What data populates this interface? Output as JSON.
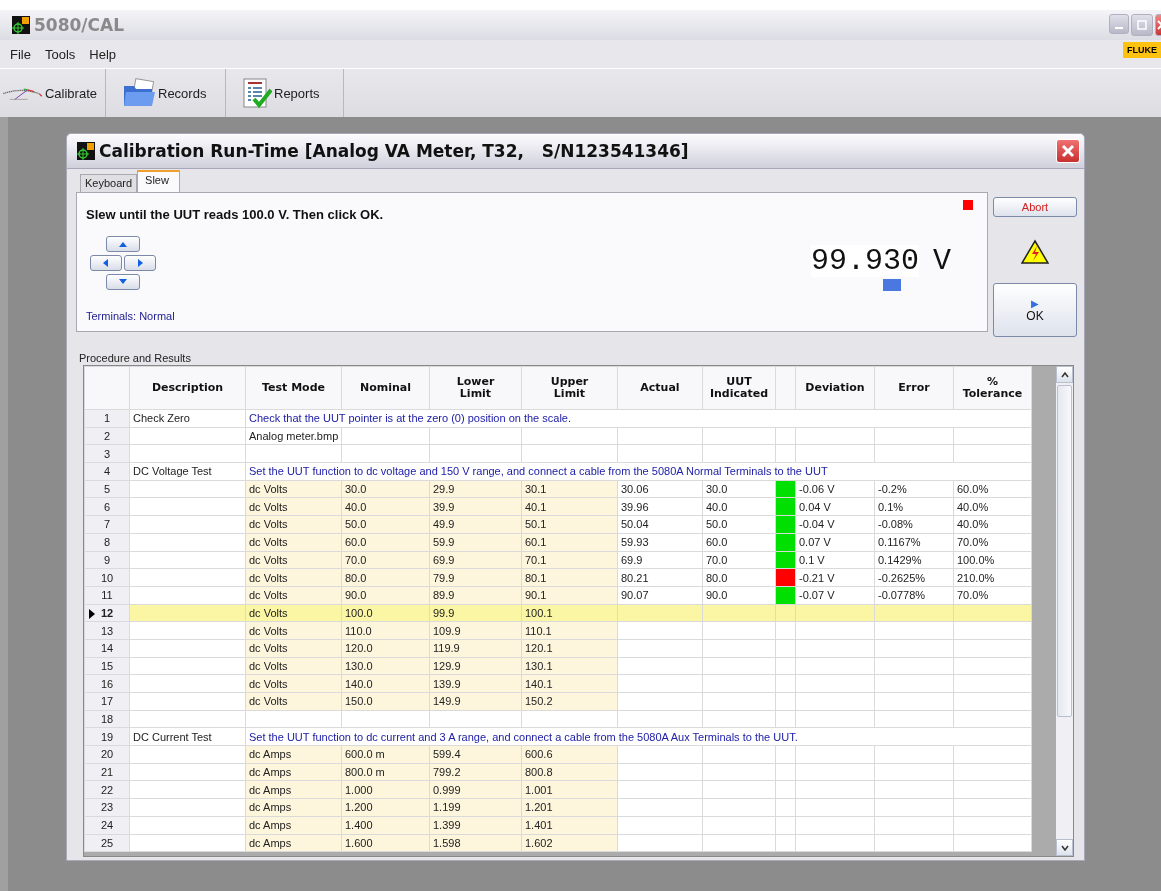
{
  "window": {
    "title": "5080/CAL",
    "brand": "FLUKE"
  },
  "menu": [
    "File",
    "Tools",
    "Help"
  ],
  "toolbar": [
    {
      "label": "Calibrate",
      "kind": "gauge"
    },
    {
      "label": "Records",
      "kind": "folder"
    },
    {
      "label": "Reports",
      "kind": "report"
    }
  ],
  "dialog": {
    "title": "Calibration Run-Time [Analog VA Meter, T32,   S/N123541346]",
    "tabs": [
      {
        "label": "Keyboard",
        "selected": false
      },
      {
        "label": "Slew",
        "selected": true
      }
    ],
    "prompt": "Slew until the UUT reads 100.0 V. Then click OK.",
    "terminals": "Terminals: Normal",
    "readout": {
      "digits": [
        {
          "char": "9",
          "selected": false
        },
        {
          "char": "9",
          "selected": false
        },
        {
          "char": ".",
          "selected": false
        },
        {
          "char": "9",
          "selected": false
        },
        {
          "char": "3",
          "selected": true
        },
        {
          "char": "0",
          "selected": false
        }
      ],
      "unit": "V"
    },
    "buttons": {
      "abort": "Abort",
      "ok": "OK",
      "ok_icon": "▶"
    },
    "results_label": "Procedure and Results",
    "columns": [
      {
        "kind": "text",
        "label": "Description"
      },
      {
        "kind": "text",
        "label": "Test Mode"
      },
      {
        "kind": "text",
        "label": "Nominal"
      },
      {
        "kind": "text",
        "label": "Lower Limit"
      },
      {
        "kind": "text",
        "label": "Upper Limit"
      },
      {
        "kind": "text",
        "label": "Actual"
      },
      {
        "kind": "text",
        "label": "UUT Indicated"
      },
      {
        "kind": "status"
      },
      {
        "kind": "text",
        "label": "Deviation"
      },
      {
        "kind": "text",
        "label": "Error"
      },
      {
        "kind": "text",
        "label": "% Tolerance"
      }
    ],
    "rows": [
      {
        "number": "1",
        "kind": "instruction",
        "selected": false,
        "description": "Check Zero",
        "text": "Check that the UUT pointer is at the zero (0) position on the scale."
      },
      {
        "number": "2",
        "kind": "file",
        "selected": false,
        "text": "Analog meter.bmp"
      },
      {
        "number": "3",
        "kind": "blank",
        "selected": false
      },
      {
        "number": "4",
        "kind": "instruction",
        "selected": false,
        "description": "DC Voltage Test",
        "text": "Set the UUT function to dc voltage and 150 V range, and connect  a cable from the 5080A Normal Terminals to the UUT"
      },
      {
        "number": "5",
        "kind": "test",
        "selected": false,
        "test_mode": "dc Volts",
        "nominal": "30.0",
        "lower": "29.9",
        "upper": "30.1",
        "actual": "30.06",
        "uut_indicated": "30.0",
        "color": "#00e000",
        "deviation": "-0.06 V",
        "error": "-0.2%",
        "tolerance": "60.0%"
      },
      {
        "number": "6",
        "kind": "test",
        "selected": false,
        "test_mode": "dc Volts",
        "nominal": "40.0",
        "lower": "39.9",
        "upper": "40.1",
        "actual": "39.96",
        "uut_indicated": "40.0",
        "color": "#00e000",
        "deviation": "0.04 V",
        "error": "0.1%",
        "tolerance": "40.0%"
      },
      {
        "number": "7",
        "kind": "test",
        "selected": false,
        "test_mode": "dc Volts",
        "nominal": "50.0",
        "lower": "49.9",
        "upper": "50.1",
        "actual": "50.04",
        "uut_indicated": "50.0",
        "color": "#00e000",
        "deviation": "-0.04 V",
        "error": "-0.08%",
        "tolerance": "40.0%"
      },
      {
        "number": "8",
        "kind": "test",
        "selected": false,
        "test_mode": "dc Volts",
        "nominal": "60.0",
        "lower": "59.9",
        "upper": "60.1",
        "actual": "59.93",
        "uut_indicated": "60.0",
        "color": "#00e000",
        "deviation": "0.07 V",
        "error": "0.1167%",
        "tolerance": "70.0%"
      },
      {
        "number": "9",
        "kind": "test",
        "selected": false,
        "test_mode": "dc Volts",
        "nominal": "70.0",
        "lower": "69.9",
        "upper": "70.1",
        "actual": "69.9",
        "uut_indicated": "70.0",
        "color": "#00e000",
        "deviation": "0.1 V",
        "error": "0.1429%",
        "tolerance": "100.0%"
      },
      {
        "number": "10",
        "kind": "test",
        "selected": false,
        "test_mode": "dc Volts",
        "nominal": "80.0",
        "lower": "79.9",
        "upper": "80.1",
        "actual": "80.21",
        "uut_indicated": "80.0",
        "color": "#ff0000",
        "deviation": "-0.21 V",
        "error": "-0.2625%",
        "tolerance": "210.0%"
      },
      {
        "number": "11",
        "kind": "test",
        "selected": false,
        "test_mode": "dc Volts",
        "nominal": "90.0",
        "lower": "89.9",
        "upper": "90.1",
        "actual": "90.07",
        "uut_indicated": "90.0",
        "color": "#00e000",
        "deviation": "-0.07 V",
        "error": "-0.0778%",
        "tolerance": "70.0%"
      },
      {
        "number": "12",
        "kind": "test",
        "selected": true,
        "test_mode": "dc Volts",
        "nominal": "100.0",
        "lower": "99.9",
        "upper": "100.1"
      },
      {
        "number": "13",
        "kind": "test",
        "selected": false,
        "test_mode": "dc Volts",
        "nominal": "110.0",
        "lower": "109.9",
        "upper": "110.1"
      },
      {
        "number": "14",
        "kind": "test",
        "selected": false,
        "test_mode": "dc Volts",
        "nominal": "120.0",
        "lower": "119.9",
        "upper": "120.1"
      },
      {
        "number": "15",
        "kind": "test",
        "selected": false,
        "test_mode": "dc Volts",
        "nominal": "130.0",
        "lower": "129.9",
        "upper": "130.1"
      },
      {
        "number": "16",
        "kind": "test",
        "selected": false,
        "test_mode": "dc Volts",
        "nominal": "140.0",
        "lower": "139.9",
        "upper": "140.1"
      },
      {
        "number": "17",
        "kind": "test",
        "selected": false,
        "test_mode": "dc Volts",
        "nominal": "150.0",
        "lower": "149.9",
        "upper": "150.2"
      },
      {
        "number": "18",
        "kind": "blank",
        "selected": false
      },
      {
        "number": "19",
        "kind": "instruction",
        "selected": false,
        "description": "DC Current Test",
        "text": "Set the UUT function to dc current and 3 A range, and connect a cable from the 5080A Aux Terminals to the UUT."
      },
      {
        "number": "20",
        "kind": "test",
        "selected": false,
        "test_mode": "dc Amps",
        "nominal": "600.0 m",
        "lower": "599.4",
        "upper": "600.6"
      },
      {
        "number": "21",
        "kind": "test",
        "selected": false,
        "test_mode": "dc Amps",
        "nominal": "800.0 m",
        "lower": "799.2",
        "upper": "800.8"
      },
      {
        "number": "22",
        "kind": "test",
        "selected": false,
        "test_mode": "dc Amps",
        "nominal": "1.000",
        "lower": "0.999",
        "upper": "1.001"
      },
      {
        "number": "23",
        "kind": "test",
        "selected": false,
        "test_mode": "dc Amps",
        "nominal": "1.200",
        "lower": "1.199",
        "upper": "1.201"
      },
      {
        "number": "24",
        "kind": "test",
        "selected": false,
        "test_mode": "dc Amps",
        "nominal": "1.400",
        "lower": "1.399",
        "upper": "1.401"
      },
      {
        "number": "25",
        "kind": "test",
        "selected": false,
        "test_mode": "dc Amps",
        "nominal": "1.600",
        "lower": "1.598",
        "upper": "1.602"
      }
    ]
  }
}
